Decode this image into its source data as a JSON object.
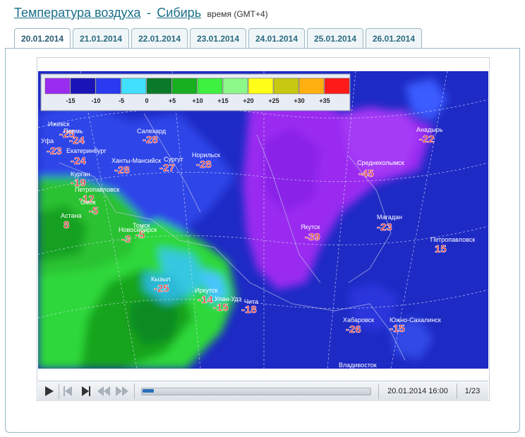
{
  "header": {
    "title_link": "Температура воздуха",
    "separator": "-",
    "region_link": "Сибирь",
    "tz_label": "время (GMT+4)"
  },
  "tabs": [
    {
      "label": "20.01.2014",
      "active": true
    },
    {
      "label": "21.01.2014",
      "active": false
    },
    {
      "label": "22.01.2014",
      "active": false
    },
    {
      "label": "23.01.2014",
      "active": false
    },
    {
      "label": "24.01.2014",
      "active": false
    },
    {
      "label": "25.01.2014",
      "active": false
    },
    {
      "label": "26.01.2014",
      "active": false
    }
  ],
  "legend": {
    "colors": [
      "#9a2cf0",
      "#1a14b8",
      "#2a3af0",
      "#42e0ff",
      "#0a7a2a",
      "#18b020",
      "#3ef040",
      "#8cf88a",
      "#ffff18",
      "#c8c810",
      "#ffb010",
      "#ff1a1a"
    ],
    "labels": [
      "-15",
      "-10",
      "-5",
      "0",
      "+5",
      "+10",
      "+15",
      "+20",
      "+25",
      "+30",
      "+35"
    ]
  },
  "cities": [
    {
      "name": "Ижевск",
      "temp": "-25"
    },
    {
      "name": "Пермь",
      "temp": "-24"
    },
    {
      "name": "Уфа",
      "temp": "-23"
    },
    {
      "name": "Екатеринбург",
      "temp": "-24"
    },
    {
      "name": "Салехард",
      "temp": "-28"
    },
    {
      "name": "Ханты-Мансийск",
      "temp": "-28"
    },
    {
      "name": "Сургут",
      "temp": "-27"
    },
    {
      "name": "Норильск",
      "temp": "-28"
    },
    {
      "name": "Курган",
      "temp": "-19"
    },
    {
      "name": "Петропавловск",
      "temp": "-12"
    },
    {
      "name": "Омск",
      "temp": "-5"
    },
    {
      "name": "Астана",
      "temp": "8"
    },
    {
      "name": "Томск",
      "temp": "-5"
    },
    {
      "name": "Новосибирск",
      "temp": "-3"
    },
    {
      "name": "Кызыл",
      "temp": "-25"
    },
    {
      "name": "Иркутск",
      "temp": "-14"
    },
    {
      "name": "Улан-Удэ",
      "temp": "-15"
    },
    {
      "name": "Чита",
      "temp": "-18"
    },
    {
      "name": "Якутск",
      "temp": "-39"
    },
    {
      "name": "Среднеколымск",
      "temp": "-45"
    },
    {
      "name": "Анадырь",
      "temp": "-22"
    },
    {
      "name": "Магадан",
      "temp": "-23"
    },
    {
      "name": "Петропавловск",
      "temp": "15"
    },
    {
      "name": "Хабаровск",
      "temp": "-26"
    },
    {
      "name": "Южно-Сахалинск",
      "temp": "-15"
    },
    {
      "name": "Владивосток",
      "temp": ""
    }
  ],
  "player": {
    "datetime": "20.01.2014 16:00",
    "frame": "1/23",
    "progress": 0.05
  }
}
